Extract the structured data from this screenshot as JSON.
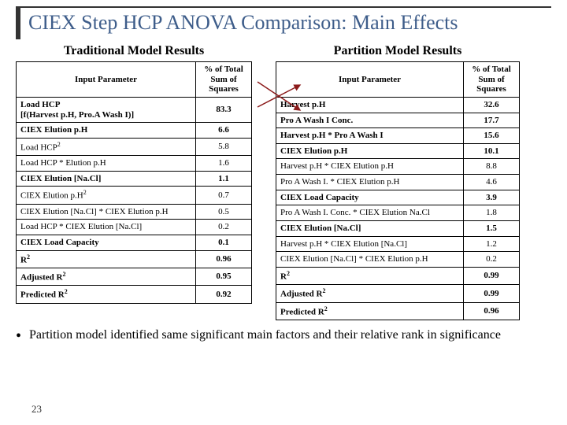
{
  "title": "CIEX Step HCP ANOVA Comparison: Main Effects",
  "left": {
    "heading": "Traditional Model Results",
    "col1": "Input Parameter",
    "col2": "% of Total Sum of Squares",
    "rows": [
      {
        "p": "Load HCP\n[f(Harvest p.H, Pro.A Wash I)]",
        "v": "83.3",
        "bold": true
      },
      {
        "p": "CIEX Elution p.H",
        "v": "6.6",
        "bold": true
      },
      {
        "p": "Load HCP²",
        "v": "5.8"
      },
      {
        "p": "Load HCP * Elution p.H",
        "v": "1.6"
      },
      {
        "p": "CIEX Elution [Na.Cl]",
        "v": "1.1",
        "bold": true
      },
      {
        "p": "CIEX Elution p.H²",
        "v": "0.7"
      },
      {
        "p": "CIEX Elution [Na.Cl] * CIEX Elution p.H",
        "v": "0.5"
      },
      {
        "p": "Load HCP * CIEX Elution [Na.Cl]",
        "v": "0.2"
      },
      {
        "p": "CIEX Load Capacity",
        "v": "0.1",
        "bold": true
      },
      {
        "p": "R²",
        "v": "0.96",
        "bold": true
      },
      {
        "p": "Adjusted R²",
        "v": "0.95",
        "bold": true
      },
      {
        "p": "Predicted R²",
        "v": "0.92",
        "bold": true
      }
    ]
  },
  "right": {
    "heading": "Partition Model Results",
    "col1": "Input Parameter",
    "col2": "% of Total Sum of Squares",
    "rows": [
      {
        "p": "Harvest p.H",
        "v": "32.6",
        "bold": true
      },
      {
        "p": "Pro A Wash I Conc.",
        "v": "17.7",
        "bold": true
      },
      {
        "p": "Harvest p.H * Pro A Wash I",
        "v": "15.6",
        "bold": true
      },
      {
        "p": "CIEX Elution p.H",
        "v": "10.1",
        "bold": true
      },
      {
        "p": "Harvest p.H * CIEX Elution p.H",
        "v": "8.8"
      },
      {
        "p": "Pro A Wash I. * CIEX Elution p.H",
        "v": "4.6"
      },
      {
        "p": "CIEX Load Capacity",
        "v": "3.9",
        "bold": true
      },
      {
        "p": "Pro A Wash I. Conc. * CIEX Elution Na.Cl",
        "v": "1.8"
      },
      {
        "p": "CIEX Elution [Na.Cl]",
        "v": "1.5",
        "bold": true
      },
      {
        "p": "Harvest p.H * CIEX Elution [Na.Cl]",
        "v": "1.2"
      },
      {
        "p": "CIEX Elution [Na.Cl] * CIEX Elution p.H",
        "v": "0.2"
      },
      {
        "p": "R²",
        "v": "0.99",
        "bold": true
      },
      {
        "p": "Adjusted R²",
        "v": "0.99",
        "bold": true
      },
      {
        "p": "Predicted R²",
        "v": "0.96",
        "bold": true
      }
    ]
  },
  "bullet": "Partition model identified same significant main factors and their relative rank in significance",
  "page": "23"
}
